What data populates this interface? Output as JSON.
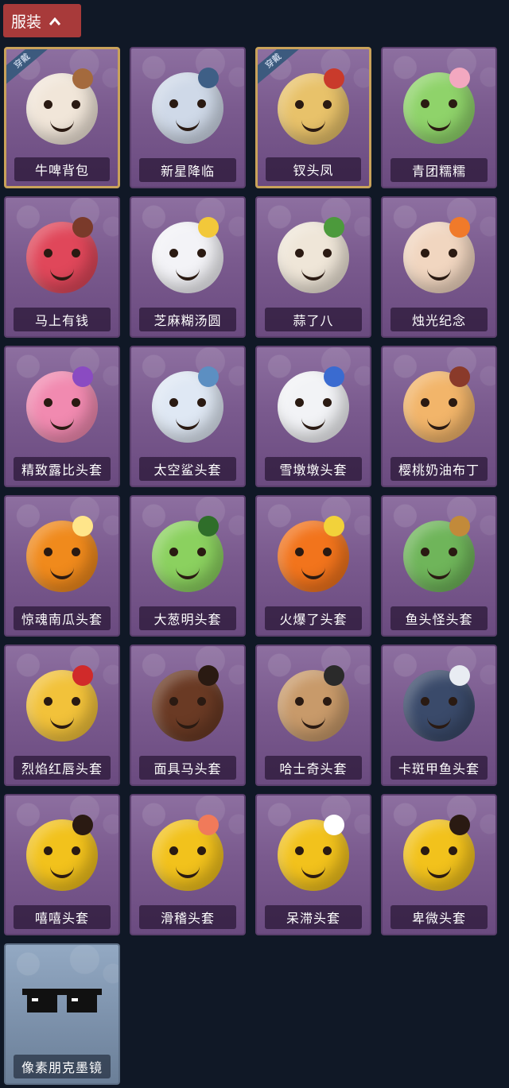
{
  "header": {
    "tab_label": "服装",
    "chevron_icon": "chevron-up-icon"
  },
  "badge_text": "穿戴",
  "items": [
    {
      "name": "牛啤背包",
      "equipped": true,
      "color": "#f1e6d9",
      "accent": "#a46a3d"
    },
    {
      "name": "新星降临",
      "equipped": false,
      "color": "#cfd9e8",
      "accent": "#3e5f86"
    },
    {
      "name": "钗头凤",
      "equipped": true,
      "color": "#e8c26a",
      "accent": "#c93a2b"
    },
    {
      "name": "青团糯糯",
      "equipped": false,
      "color": "#8fd36a",
      "accent": "#f3a8c0"
    },
    {
      "name": "马上有钱",
      "equipped": false,
      "color": "#e0475a",
      "accent": "#7a3a2a"
    },
    {
      "name": "芝麻糊汤圆",
      "equipped": false,
      "color": "#f3f3f7",
      "accent": "#f2c83a"
    },
    {
      "name": "蒜了八",
      "equipped": false,
      "color": "#efe6d8",
      "accent": "#4c9a3c"
    },
    {
      "name": "烛光纪念",
      "equipped": false,
      "color": "#f1d6c0",
      "accent": "#f07a2a"
    },
    {
      "name": "精致露比头套",
      "equipped": false,
      "color": "#f18ab0",
      "accent": "#8a4bc2"
    },
    {
      "name": "太空鲨头套",
      "equipped": false,
      "color": "#dfe8f4",
      "accent": "#5c8fc2"
    },
    {
      "name": "雪墩墩头套",
      "equipped": false,
      "color": "#f2f3f6",
      "accent": "#3a6bd0"
    },
    {
      "name": "樱桃奶油布丁",
      "equipped": false,
      "color": "#f2b56a",
      "accent": "#8a3a2a"
    },
    {
      "name": "惊魂南瓜头套",
      "equipped": false,
      "color": "#f08a1c",
      "accent": "#ffe58a"
    },
    {
      "name": "大葱明头套",
      "equipped": false,
      "color": "#8bd15f",
      "accent": "#2f6e2a"
    },
    {
      "name": "火爆了头套",
      "equipped": false,
      "color": "#f2741c",
      "accent": "#f2d23a"
    },
    {
      "name": "鱼头怪头套",
      "equipped": false,
      "color": "#6fb55a",
      "accent": "#c28a3a"
    },
    {
      "name": "烈焰红唇头套",
      "equipped": false,
      "color": "#f2c23a",
      "accent": "#d02a2a"
    },
    {
      "name": "面具马头套",
      "equipped": false,
      "color": "#6a3a24",
      "accent": "#2a1a12"
    },
    {
      "name": "哈士奇头套",
      "equipped": false,
      "color": "#c89a6a",
      "accent": "#2a2a2a"
    },
    {
      "name": "卡斑甲鱼头套",
      "equipped": false,
      "color": "#3a4a6a",
      "accent": "#e8ecf2"
    },
    {
      "name": "嘻嘻头套",
      "equipped": false,
      "color": "#f2c21c",
      "accent": "#2a1a12"
    },
    {
      "name": "滑稽头套",
      "equipped": false,
      "color": "#f2c21c",
      "accent": "#f07a5a"
    },
    {
      "name": "呆滞头套",
      "equipped": false,
      "color": "#f2c21c",
      "accent": "#ffffff"
    },
    {
      "name": "卑微头套",
      "equipped": false,
      "color": "#f2c21c",
      "accent": "#2a1a12"
    },
    {
      "name": "像素朋克墨镜",
      "equipped": false,
      "color": "#111111",
      "accent": "#ffffff",
      "variant": "blue"
    }
  ]
}
